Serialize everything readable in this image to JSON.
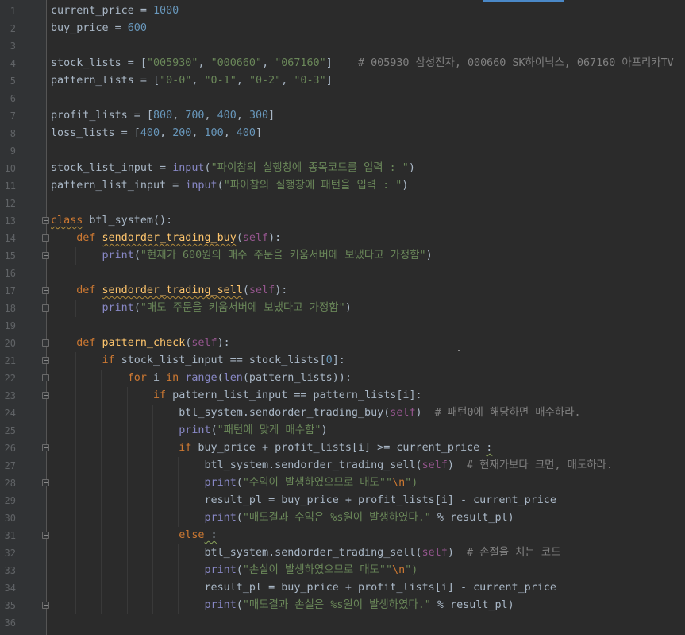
{
  "editor": {
    "lines": [
      [
        {
          "t": "current_price = ",
          "c": ""
        },
        {
          "t": "1000",
          "c": "num"
        }
      ],
      [
        {
          "t": "buy_price = ",
          "c": ""
        },
        {
          "t": "600",
          "c": "num"
        }
      ],
      [],
      [
        {
          "t": "stock_lists = [",
          "c": ""
        },
        {
          "t": "\"005930\"",
          "c": "str"
        },
        {
          "t": ", ",
          "c": ""
        },
        {
          "t": "\"000660\"",
          "c": "str"
        },
        {
          "t": ", ",
          "c": ""
        },
        {
          "t": "\"067160\"",
          "c": "str"
        },
        {
          "t": "]    ",
          "c": ""
        },
        {
          "t": "# 005930 삼성전자, 000660 SK하이닉스, 067160 아프리카TV",
          "c": "cm"
        }
      ],
      [
        {
          "t": "pattern_lists = [",
          "c": ""
        },
        {
          "t": "\"0-0\"",
          "c": "str"
        },
        {
          "t": ", ",
          "c": ""
        },
        {
          "t": "\"0-1\"",
          "c": "str"
        },
        {
          "t": ", ",
          "c": ""
        },
        {
          "t": "\"0-2\"",
          "c": "str"
        },
        {
          "t": ", ",
          "c": ""
        },
        {
          "t": "\"0-3\"",
          "c": "str"
        },
        {
          "t": "]",
          "c": ""
        }
      ],
      [],
      [
        {
          "t": "profit_lists = [",
          "c": ""
        },
        {
          "t": "800",
          "c": "num"
        },
        {
          "t": ", ",
          "c": ""
        },
        {
          "t": "700",
          "c": "num"
        },
        {
          "t": ", ",
          "c": ""
        },
        {
          "t": "400",
          "c": "num"
        },
        {
          "t": ", ",
          "c": ""
        },
        {
          "t": "300",
          "c": "num"
        },
        {
          "t": "]",
          "c": ""
        }
      ],
      [
        {
          "t": "loss_lists = [",
          "c": ""
        },
        {
          "t": "400",
          "c": "num"
        },
        {
          "t": ", ",
          "c": ""
        },
        {
          "t": "200",
          "c": "num"
        },
        {
          "t": ", ",
          "c": ""
        },
        {
          "t": "100",
          "c": "num"
        },
        {
          "t": ", ",
          "c": ""
        },
        {
          "t": "400",
          "c": "num"
        },
        {
          "t": "]",
          "c": ""
        }
      ],
      [],
      [
        {
          "t": "stock_list_input = ",
          "c": ""
        },
        {
          "t": "input",
          "c": "bi"
        },
        {
          "t": "(",
          "c": ""
        },
        {
          "t": "\"파이참의 실행창에 종목코드를 입력 : \"",
          "c": "str"
        },
        {
          "t": ")",
          "c": ""
        }
      ],
      [
        {
          "t": "pattern_list_input = ",
          "c": ""
        },
        {
          "t": "input",
          "c": "bi"
        },
        {
          "t": "(",
          "c": ""
        },
        {
          "t": "\"파이참의 실행창에 패턴을 입력 : \"",
          "c": "str"
        },
        {
          "t": ")",
          "c": ""
        }
      ],
      [],
      [
        {
          "t": "class",
          "c": "kw squig-y"
        },
        {
          "t": " btl_system():",
          "c": ""
        }
      ],
      [
        {
          "t": "    ",
          "c": ""
        },
        {
          "t": "def",
          "c": "kw"
        },
        {
          "t": " ",
          "c": ""
        },
        {
          "t": "sendorder_trading_buy",
          "c": "fn squig-y"
        },
        {
          "t": "(",
          "c": ""
        },
        {
          "t": "self",
          "c": "self"
        },
        {
          "t": "):",
          "c": ""
        }
      ],
      [
        {
          "t": "        ",
          "c": ""
        },
        {
          "t": "print",
          "c": "bi"
        },
        {
          "t": "(",
          "c": ""
        },
        {
          "t": "\"현재가 600원의 매수 주문을 키움서버에 보냈다고 가정함\"",
          "c": "str"
        },
        {
          "t": ")",
          "c": ""
        }
      ],
      [],
      [
        {
          "t": "    ",
          "c": ""
        },
        {
          "t": "def",
          "c": "kw"
        },
        {
          "t": " ",
          "c": ""
        },
        {
          "t": "sendorder_trading_sell",
          "c": "fn squig-y"
        },
        {
          "t": "(",
          "c": ""
        },
        {
          "t": "self",
          "c": "self"
        },
        {
          "t": "):",
          "c": ""
        }
      ],
      [
        {
          "t": "        ",
          "c": ""
        },
        {
          "t": "print",
          "c": "bi"
        },
        {
          "t": "(",
          "c": ""
        },
        {
          "t": "\"매도 주문을 키움서버에 보냈다고 가정함\"",
          "c": "str"
        },
        {
          "t": ")",
          "c": ""
        }
      ],
      [],
      [
        {
          "t": "    ",
          "c": ""
        },
        {
          "t": "def",
          "c": "kw"
        },
        {
          "t": " ",
          "c": ""
        },
        {
          "t": "pattern_check",
          "c": "fn"
        },
        {
          "t": "(",
          "c": ""
        },
        {
          "t": "self",
          "c": "self"
        },
        {
          "t": "):",
          "c": ""
        }
      ],
      [
        {
          "t": "        ",
          "c": ""
        },
        {
          "t": "if",
          "c": "kw"
        },
        {
          "t": " stock_list_input == stock_lists[",
          "c": ""
        },
        {
          "t": "0",
          "c": "num"
        },
        {
          "t": "]:",
          "c": ""
        }
      ],
      [
        {
          "t": "            ",
          "c": ""
        },
        {
          "t": "for",
          "c": "kw"
        },
        {
          "t": " i ",
          "c": ""
        },
        {
          "t": "in",
          "c": "kw"
        },
        {
          "t": " ",
          "c": ""
        },
        {
          "t": "range",
          "c": "bi"
        },
        {
          "t": "(",
          "c": ""
        },
        {
          "t": "len",
          "c": "bi"
        },
        {
          "t": "(pattern_lists)):",
          "c": ""
        }
      ],
      [
        {
          "t": "                ",
          "c": ""
        },
        {
          "t": "if",
          "c": "kw"
        },
        {
          "t": " pattern_list_input == pattern_lists[i]:",
          "c": ""
        }
      ],
      [
        {
          "t": "                    btl_system.sendorder_trading_buy(",
          "c": ""
        },
        {
          "t": "self",
          "c": "self"
        },
        {
          "t": ")  ",
          "c": ""
        },
        {
          "t": "# 패턴0에 해당하면 매수하라.",
          "c": "cm"
        }
      ],
      [
        {
          "t": "                    ",
          "c": ""
        },
        {
          "t": "print",
          "c": "bi"
        },
        {
          "t": "(",
          "c": ""
        },
        {
          "t": "\"패턴에 맞게 매수함\"",
          "c": "str"
        },
        {
          "t": ")",
          "c": ""
        }
      ],
      [
        {
          "t": "                    ",
          "c": ""
        },
        {
          "t": "if",
          "c": "kw"
        },
        {
          "t": " buy_price + profit_lists[i] >= current_price ",
          "c": ""
        },
        {
          "t": ":",
          "c": "squig"
        }
      ],
      [
        {
          "t": "                        btl_system.sendorder_trading_sell(",
          "c": ""
        },
        {
          "t": "self",
          "c": "self"
        },
        {
          "t": ")  ",
          "c": ""
        },
        {
          "t": "# 현재가보다 크면, 매도하라.",
          "c": "cm"
        }
      ],
      [
        {
          "t": "                        ",
          "c": ""
        },
        {
          "t": "print",
          "c": "bi"
        },
        {
          "t": "(",
          "c": ""
        },
        {
          "t": "\"수익이 발생하였으므로 매도\"\"",
          "c": "str"
        },
        {
          "t": "\\n",
          "c": "esc"
        },
        {
          "t": "\")",
          "c": "str"
        }
      ],
      [
        {
          "t": "                        result_pl = buy_price + profit_lists[i] - current_price",
          "c": ""
        }
      ],
      [
        {
          "t": "                        ",
          "c": ""
        },
        {
          "t": "print",
          "c": "bi"
        },
        {
          "t": "(",
          "c": ""
        },
        {
          "t": "\"매도결과 수익은 %s원이 발생하였다.\"",
          "c": "str"
        },
        {
          "t": " % result_pl)",
          "c": ""
        }
      ],
      [
        {
          "t": "                    ",
          "c": ""
        },
        {
          "t": "else",
          "c": "kw"
        },
        {
          "t": " :",
          "c": "squig"
        }
      ],
      [
        {
          "t": "                        btl_system.sendorder_trading_sell(",
          "c": ""
        },
        {
          "t": "self",
          "c": "self"
        },
        {
          "t": ")  ",
          "c": ""
        },
        {
          "t": "# 손절을 치는 코드",
          "c": "cm"
        }
      ],
      [
        {
          "t": "                        ",
          "c": ""
        },
        {
          "t": "print",
          "c": "bi"
        },
        {
          "t": "(",
          "c": ""
        },
        {
          "t": "\"손실이 발생하였으므로 매도\"\"",
          "c": "str"
        },
        {
          "t": "\\n",
          "c": "esc"
        },
        {
          "t": "\")",
          "c": "str"
        }
      ],
      [
        {
          "t": "                        result_pl = buy_price + profit_lists[i] - current_price",
          "c": ""
        }
      ],
      [
        {
          "t": "                        ",
          "c": ""
        },
        {
          "t": "print",
          "c": "bi"
        },
        {
          "t": "(",
          "c": ""
        },
        {
          "t": "\"매도결과 손실은 %s원이 발생하였다.\"",
          "c": "str"
        },
        {
          "t": " % result_pl)",
          "c": ""
        }
      ],
      [],
      []
    ],
    "line_numbers": [
      "1",
      "2",
      "3",
      "4",
      "5",
      "6",
      "7",
      "8",
      "9",
      "10",
      "11",
      "12",
      "13",
      "14",
      "15",
      "16",
      "17",
      "18",
      "19",
      "20",
      "21",
      "22",
      "23",
      "24",
      "25",
      "26",
      "27",
      "28",
      "29",
      "30",
      "31",
      "32",
      "33",
      "34",
      "35",
      "36",
      ""
    ],
    "fold_lines": [
      13,
      14,
      15,
      17,
      18,
      20,
      21,
      22,
      23,
      26,
      28,
      31,
      35
    ],
    "colors": {
      "background": "#2b2b2b",
      "gutter": "#313335",
      "keyword": "#cc7832",
      "string": "#6a8759",
      "number": "#6897bb",
      "function": "#ffc66d",
      "self": "#94558d",
      "builtin": "#8888c6",
      "comment": "#808080",
      "text": "#a9b7c6"
    }
  }
}
